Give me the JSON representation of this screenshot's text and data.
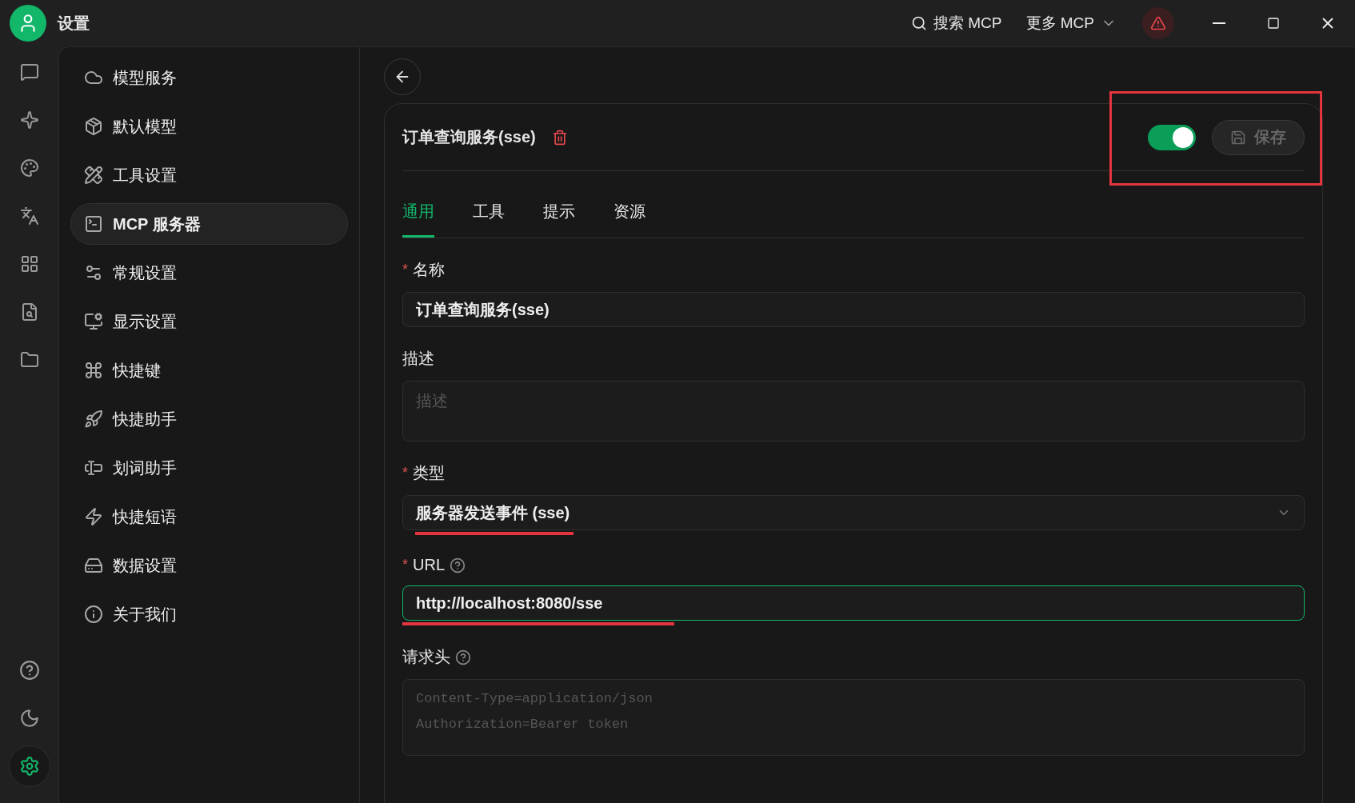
{
  "title_bar": {
    "title": "设置",
    "search_label": "搜索 MCP",
    "more_label": "更多 MCP",
    "warning": true
  },
  "rail": {
    "items": [
      {
        "selected": false
      },
      {
        "selected": false
      },
      {
        "selected": false
      },
      {
        "selected": false
      },
      {
        "selected": false
      },
      {
        "selected": false
      },
      {
        "selected": false
      }
    ],
    "bottom": [
      {
        "selected": false
      },
      {
        "selected": false
      },
      {
        "selected": true
      }
    ]
  },
  "sidebar": {
    "items": [
      {
        "label": "模型服务",
        "selected": false
      },
      {
        "label": "默认模型",
        "selected": false
      },
      {
        "label": "工具设置",
        "selected": false
      },
      {
        "label": "MCP 服务器",
        "selected": true
      },
      {
        "label": "常规设置",
        "selected": false
      },
      {
        "label": "显示设置",
        "selected": false
      },
      {
        "label": "快捷键",
        "selected": false
      },
      {
        "label": "快捷助手",
        "selected": false
      },
      {
        "label": "划词助手",
        "selected": false
      },
      {
        "label": "快捷短语",
        "selected": false
      },
      {
        "label": "数据设置",
        "selected": false
      },
      {
        "label": "关于我们",
        "selected": false
      }
    ]
  },
  "detail": {
    "title": "订单查询服务(sse)",
    "enabled": true,
    "save": {
      "label": "保存",
      "disabled": true
    },
    "actions_boxed": true,
    "tabs": [
      {
        "label": "通用",
        "selected": true
      },
      {
        "label": "工具",
        "selected": false
      },
      {
        "label": "提示",
        "selected": false
      },
      {
        "label": "资源",
        "selected": false
      }
    ],
    "fields": [
      {
        "kind": "input",
        "label": "名称",
        "required_mark": "*",
        "focused": false,
        "value": "订单查询服务(sse)"
      },
      {
        "kind": "textarea",
        "label": "描述",
        "placeholder": "描述"
      },
      {
        "kind": "select",
        "label": "类型",
        "required_mark": "*",
        "value": "服务器发送事件 (sse)",
        "underlined": true
      },
      {
        "kind": "input",
        "label": "URL",
        "required_mark": "*",
        "help": true,
        "focused": true,
        "value": "http://localhost:8080/sse",
        "underlined": true
      },
      {
        "kind": "textarea",
        "label": "请求头",
        "help": true,
        "mono": true,
        "placeholder": "Content-Type=application/json\nAuthorization=Bearer token"
      }
    ]
  }
}
